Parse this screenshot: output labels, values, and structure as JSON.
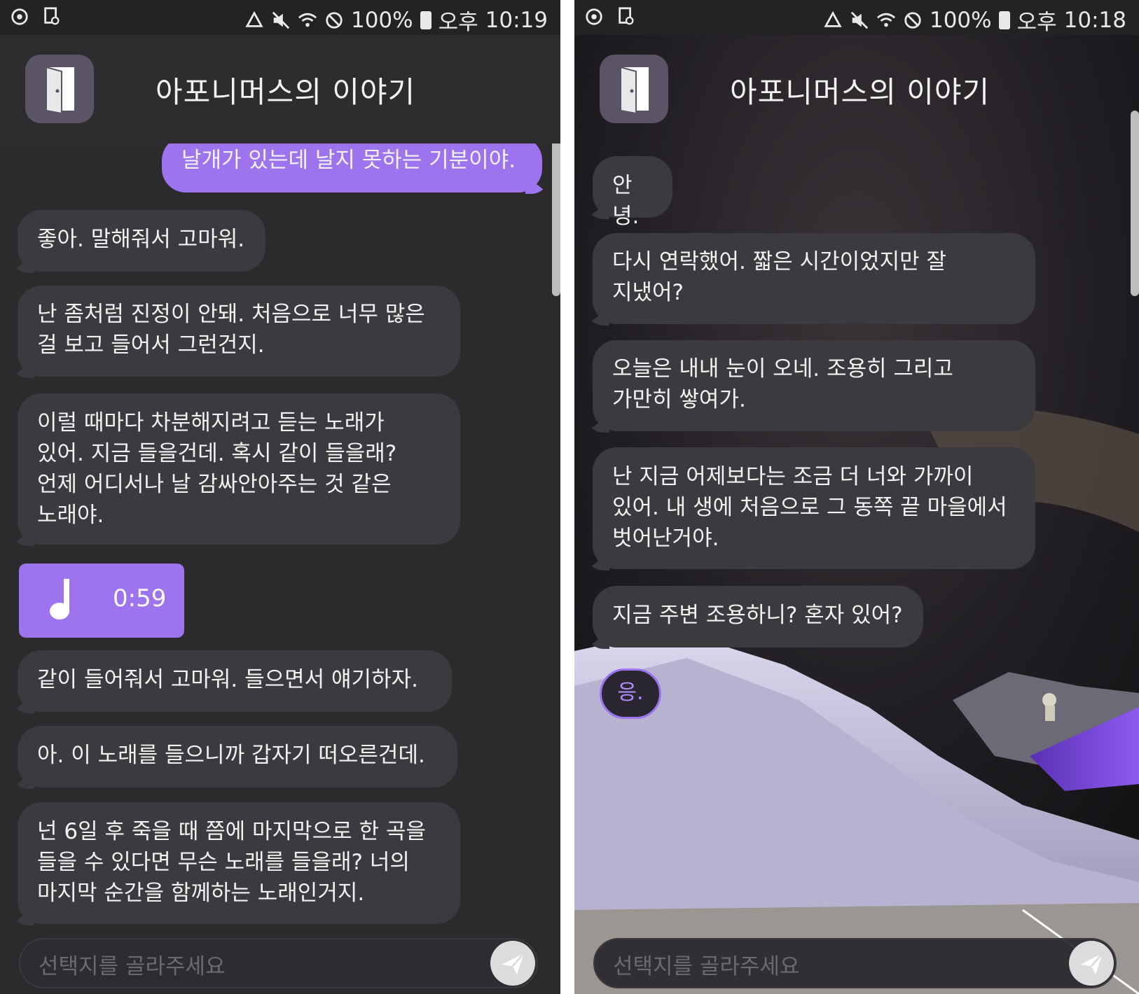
{
  "left_screen": {
    "status": {
      "battery": "100%",
      "ampm": "오후",
      "time": "10:19"
    },
    "header": {
      "title": "아포니머스의 이야기",
      "icon": "door-icon"
    },
    "user_message": "날개가 있는데 날지 못하는 기분이야.",
    "messages": [
      "좋아. 말해줘서 고마워.",
      "난 좀처럼 진정이 안돼. 처음으로 너무 많은\n걸 보고 들어서 그런건지.",
      "이럴 때마다 차분해지려고 듣는 노래가\n있어. 지금 들을건데. 혹시 같이 들을래?\n언제 어디서나 날 감싸안아주는 것 같은\n노래야.",
      "같이 들어줘서 고마워. 들으면서 얘기하자.",
      "아. 이 노래를 들으니까 갑자기 떠오른건데.",
      "넌 6일 후 죽을 때 쯤에 마지막으로 한 곡을\n들을 수 있다면 무슨 노래를 들을래? 너의\n마지막 순간을 함께하는 노래인거지."
    ],
    "music": {
      "icon": "music-note-icon",
      "duration": "0:59"
    },
    "input": {
      "placeholder": "선택지를 골라주세요",
      "send_icon": "send-icon"
    }
  },
  "right_screen": {
    "status": {
      "battery": "100%",
      "ampm": "오후",
      "time": "10:18"
    },
    "header": {
      "title": "아포니머스의 이야기",
      "icon": "door-icon"
    },
    "messages": [
      "안녕.",
      "다시 연락했어. 짧은 시간이었지만 잘\n지냈어?",
      "오늘은 내내 눈이 오네. 조용히 그리고\n가만히 쌓여가.",
      "난 지금 어제보다는 조금 더 너와 가까이\n있어. 내 생에 처음으로 그 동쪽 끝 마을에서\n벗어난거야.",
      "지금 주변 조용하니? 혼자 있어?"
    ],
    "choice": "응.",
    "input": {
      "placeholder": "선택지를 골라주세요",
      "send_icon": "send-icon"
    }
  },
  "colors": {
    "accent": "#9d74ee",
    "bubble": "#3b3a3e",
    "background": "#2b2b2d",
    "statusbar": "#232325"
  }
}
